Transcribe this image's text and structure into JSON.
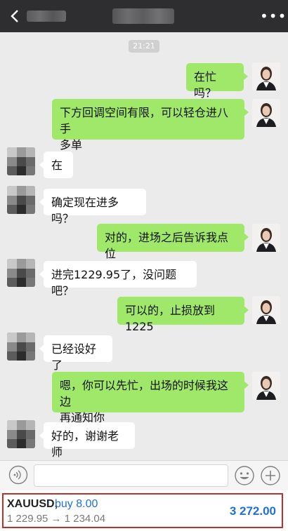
{
  "chat": {
    "timestamp": "21:21",
    "messages": [
      {
        "sender": "me",
        "text": "在忙吗？"
      },
      {
        "sender": "me",
        "text": "下方回调空间有限，可以轻仓进八手\n多单"
      },
      {
        "sender": "other",
        "text": "在"
      },
      {
        "sender": "other",
        "text": "确定现在进多吗？"
      },
      {
        "sender": "me",
        "text": "对的，进场之后告诉我点位"
      },
      {
        "sender": "other",
        "text": "进完1229.95了，没问题吧？"
      },
      {
        "sender": "me",
        "text": "可以的，止损放到1225"
      },
      {
        "sender": "other",
        "text": "已经设好了"
      },
      {
        "sender": "me",
        "text": "嗯，你可以先忙，出场的时候我这边\n再通知你"
      },
      {
        "sender": "other",
        "text": "好的，谢谢老师"
      }
    ]
  },
  "trade": {
    "symbol": "XAUUSD,",
    "side": "buy 8.00",
    "prices": "1 229.95 → 1 234.04",
    "profit": "3 272.00"
  },
  "colors": {
    "topbar": "#2e2e30",
    "chat_bg": "#ebebeb",
    "my_bubble": "#9fe86a",
    "other_bubble": "#ffffff",
    "accent_blue": "#1f6fd8",
    "trade_border": "#c0302b"
  }
}
